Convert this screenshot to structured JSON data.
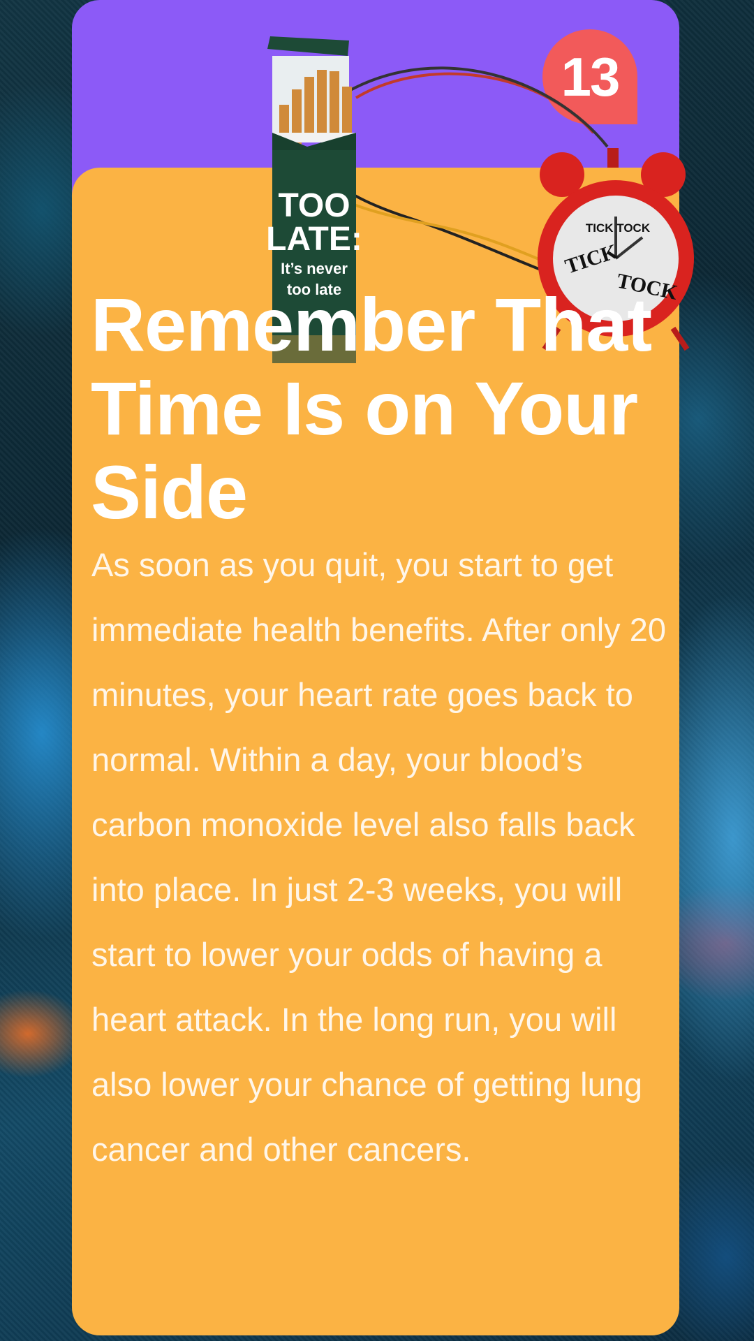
{
  "slide": {
    "number": "13",
    "title": "Remember That Time Is on Your Side",
    "body": "As soon as you quit, you start to get immediate health benefits. After only 20 minutes, your heart rate goes back to normal. Within a day, your blood’s carbon monoxide level also falls back into place. In just 2-3 weeks, you will start to lower your odds of having a heart attack. In the long run, you will also lower your chance of getting lung cancer and other cancers."
  },
  "illustration": {
    "pack_line1": "TOO",
    "pack_line2": "LATE:",
    "pack_line3": "It’s never",
    "pack_line4": "too late",
    "clock_label": "TICK TOCK",
    "clock_word1": "TICK",
    "clock_word2": "TOCK"
  },
  "colors": {
    "card_top": "#8c5af7",
    "card_main": "#fbb344",
    "badge": "#f25a5a"
  }
}
